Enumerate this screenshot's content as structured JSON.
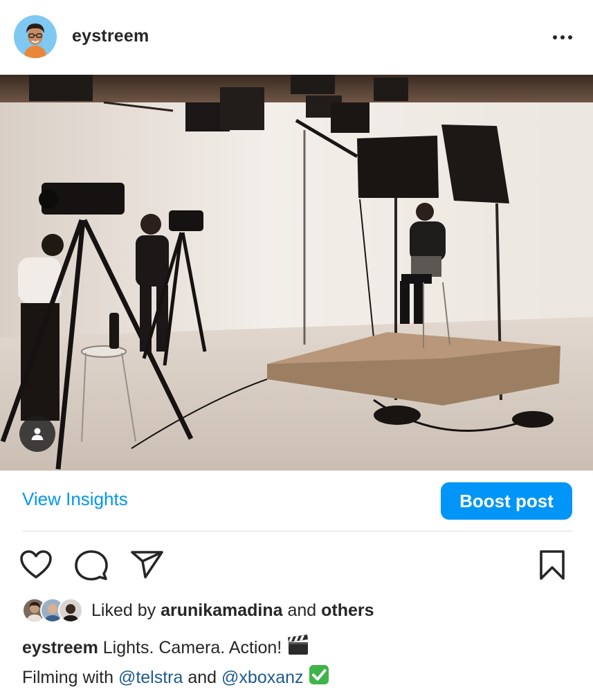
{
  "post": {
    "username": "eystreem",
    "more_icon": "more-horizontal-icon",
    "image_alt": "Studio film set: camera operators filming a seated person on a platform under lights",
    "tag_icon": "user-tag-icon"
  },
  "actions_bar": {
    "insights_label": "View Insights",
    "boost_label": "Boost post",
    "accent_color": "#0095f6"
  },
  "engagement": {
    "icons": [
      "heart-icon",
      "comment-icon",
      "send-icon",
      "bookmark-icon"
    ],
    "liked_prefix": "Liked by",
    "liked_user": "arunikamadina",
    "liked_and": "and",
    "liked_others": "others"
  },
  "caption": {
    "username": "eystreem",
    "line1_text": "Lights. Camera. Action!",
    "line2_prefix": "Filming with",
    "mention1": "@telstra",
    "line2_and": "and",
    "mention2": "@xboxanz"
  }
}
